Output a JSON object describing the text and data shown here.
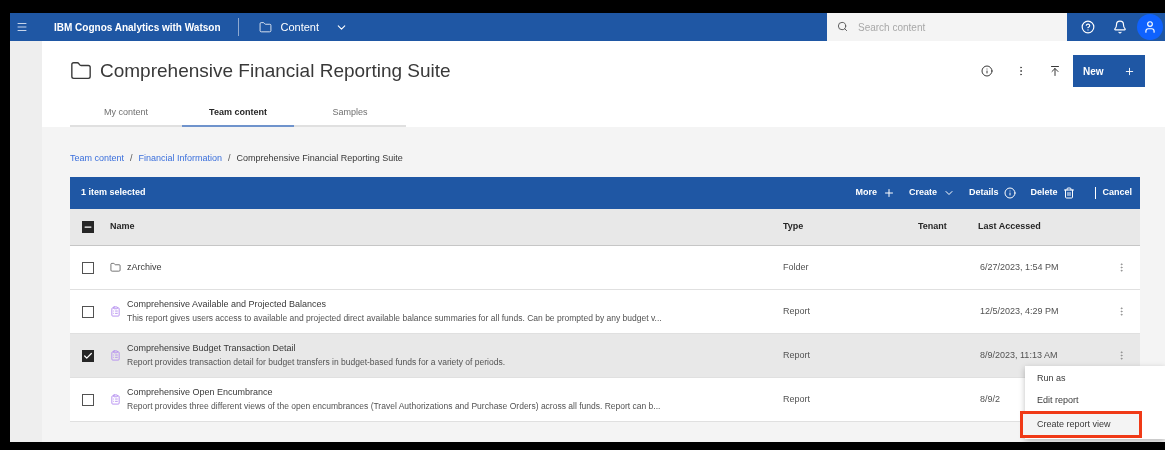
{
  "header": {
    "product": "IBM Cognos Analytics with Watson",
    "nav": "Content",
    "search": {
      "placeholder": "Search content"
    }
  },
  "page": {
    "title": "Comprehensive Financial Reporting Suite",
    "new_button": "New"
  },
  "tabs": [
    {
      "label": "My content",
      "selected": false
    },
    {
      "label": "Team content",
      "selected": true
    },
    {
      "label": "Samples",
      "selected": false
    }
  ],
  "breadcrumb": [
    {
      "kind": "link",
      "label": "Team content"
    },
    {
      "kind": "separator",
      "label": "/"
    },
    {
      "kind": "link",
      "label": "Financial Information"
    },
    {
      "kind": "separator",
      "label": "/"
    },
    {
      "kind": "current",
      "label": "Comprehensive Financial Reporting Suite"
    }
  ],
  "selection_bar": {
    "label": "1 item selected",
    "actions": [
      {
        "label": "More",
        "kind": "add"
      },
      {
        "label": "Create",
        "kind": "dropdown"
      },
      {
        "label": "Details",
        "kind": "details"
      },
      {
        "label": "Delete",
        "kind": "delete"
      },
      {
        "label": "Cancel",
        "kind": "cancel"
      }
    ]
  },
  "table": {
    "select_all": {
      "indeterminate": true
    },
    "columns": [
      "Name",
      "Type",
      "Tenant",
      "Last Accessed"
    ],
    "rows": [
      {
        "kind": "folder",
        "checked": false,
        "name": "zArchive",
        "type": "Folder",
        "last_accessed": "6/27/2023, 1:54 PM",
        "menu": true
      },
      {
        "kind": "report",
        "checked": false,
        "name": "Comprehensive Available and Projected Balances",
        "description": "This report gives users access to available and projected direct available balance summaries for all funds. Can be prompted by any budget v...",
        "type": "Report",
        "last_accessed": "12/5/2023, 4:29 PM",
        "menu": true
      },
      {
        "kind": "report",
        "checked": true,
        "name": "Comprehensive Budget Transaction Detail",
        "description": "Report provides transaction detail for budget transfers in budget-based funds for a variety of periods.",
        "type": "Report",
        "last_accessed": "8/9/2023, 11:13 AM",
        "menu": true
      },
      {
        "kind": "report",
        "checked": false,
        "name": "Comprehensive Open Encumbrance",
        "description": "Report provides three different views of the open encumbrances (Travel Authorizations and Purchase Orders) across all funds. Report can b...",
        "type": "Report",
        "last_accessed": "8/9/2",
        "menu": false
      }
    ]
  },
  "context_menu": [
    {
      "label": "Run as",
      "highlighted": false
    },
    {
      "label": "Edit report",
      "highlighted": false
    },
    {
      "label": "Create report view",
      "highlighted": true
    }
  ]
}
